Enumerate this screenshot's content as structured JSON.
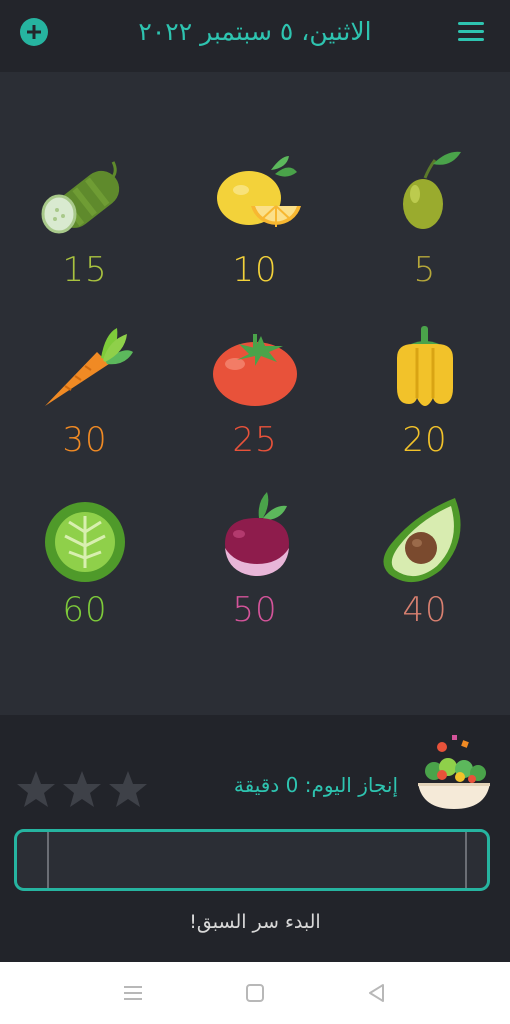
{
  "header": {
    "date_title": "الاثنين، ٥ سبتمبر ٢٠٢٢",
    "add_icon": "plus-circle-icon",
    "menu_icon": "hamburger-menu-icon",
    "accent_color": "#2ec4b0"
  },
  "vegetables": [
    {
      "name": "cucumber",
      "count": "15",
      "color": "#a9c23f"
    },
    {
      "name": "lemon",
      "count": "10",
      "color": "#f3d23a"
    },
    {
      "name": "olive",
      "count": "5",
      "color": "#b6a83a"
    },
    {
      "name": "carrot",
      "count": "30",
      "color": "#f08a24"
    },
    {
      "name": "tomato",
      "count": "25",
      "color": "#e8523a"
    },
    {
      "name": "yellow-pepper",
      "count": "20",
      "color": "#f2c22a"
    },
    {
      "name": "cabbage",
      "count": "60",
      "color": "#7ecb3a"
    },
    {
      "name": "beet",
      "count": "50",
      "color": "#d4549a"
    },
    {
      "name": "avocado",
      "count": "40",
      "color": "#d98070"
    }
  ],
  "achievement": {
    "text": "إنجاز اليوم: 0 دقيقة",
    "stars_total": 3,
    "stars_filled": 0,
    "salad_icon": "salad-bowl-icon"
  },
  "progress": {
    "fraction": 0
  },
  "start_text": "البدء سر السبق!",
  "navbar": {
    "menu_icon": "recent-apps-icon",
    "home_icon": "home-square-icon",
    "back_icon": "back-triangle-icon"
  }
}
